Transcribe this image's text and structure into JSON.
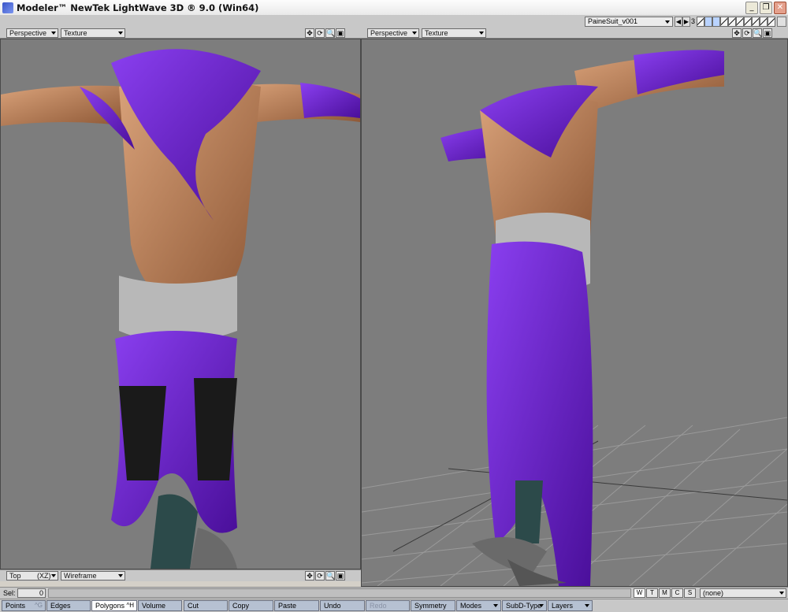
{
  "window": {
    "title": "Modeler™ NewTek LightWave 3D ® 9.0 (Win64)",
    "minimize": "_",
    "restore": "❐",
    "close": "✕"
  },
  "toolbar": {
    "object_name": "PaineSuit_v001",
    "layer_count": "3"
  },
  "viewports": {
    "left": {
      "view": "Perspective",
      "shading": "Texture"
    },
    "right": {
      "view": "Perspective",
      "shading": "Texture"
    },
    "bottom_left": {
      "view": "Top",
      "axis": "(XZ)",
      "shading": "Wireframe"
    }
  },
  "viewport_controls": [
    "✥",
    "⟳",
    "🔍",
    "▣"
  ],
  "selection": {
    "label": "Sel:",
    "count": "0"
  },
  "display_toggles": [
    "W",
    "T",
    "M",
    "C",
    "S"
  ],
  "surface": "(none)",
  "modes": [
    {
      "label": "Points",
      "key": "^G"
    },
    {
      "label": "Edges",
      "key": ""
    },
    {
      "label": "Polygons",
      "key": "^H"
    },
    {
      "label": "Volume",
      "key": ""
    },
    {
      "label": "Cut",
      "key": ""
    },
    {
      "label": "Copy",
      "key": ""
    },
    {
      "label": "Paste",
      "key": ""
    },
    {
      "label": "Undo",
      "key": ""
    },
    {
      "label": "Redo",
      "key": ""
    },
    {
      "label": "Symmetry",
      "key": ""
    },
    {
      "label": "Modes",
      "key": ""
    },
    {
      "label": "SubD-Type",
      "key": ""
    },
    {
      "label": "Layers",
      "key": ""
    }
  ],
  "colors": {
    "viewport_bg": "#7d7d7d",
    "cloth": "#6a1fc4",
    "skin": "#c98b5e",
    "metal": "#b8b8b8",
    "active_mode": "#ffffff",
    "mode_bg": "#b6c1d2"
  }
}
